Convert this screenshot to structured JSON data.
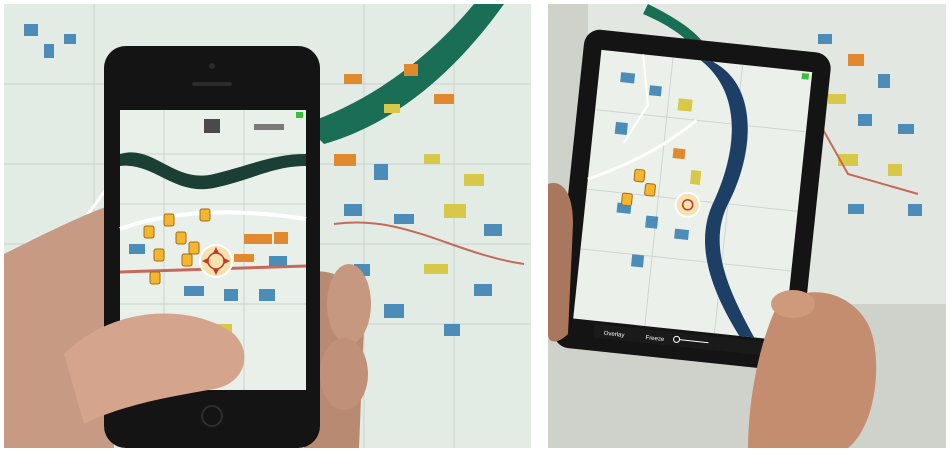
{
  "figure": {
    "panels": [
      {
        "id": "left",
        "subject": "smartphone-ar-campus-map"
      },
      {
        "id": "right",
        "subject": "tablet-ar-campus-map"
      }
    ]
  },
  "tablet_toolbar": {
    "labels": [
      "Overlay",
      "Freeze"
    ]
  },
  "colors": {
    "map_background": "#dfe8e1",
    "river": "#1a6e55",
    "road_red": "#c46a5a",
    "building_orange": "#e0892f",
    "building_blue": "#4b8db8",
    "building_yellow": "#d8c84a",
    "poi_marker": "#f2b630",
    "device_black": "#141414"
  }
}
